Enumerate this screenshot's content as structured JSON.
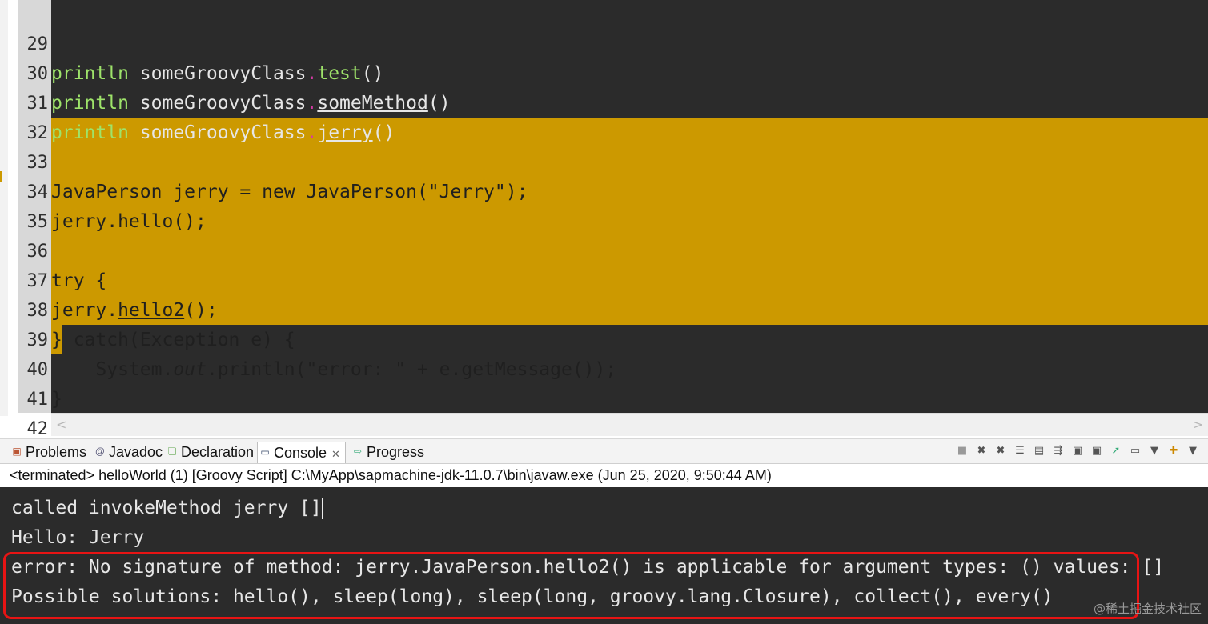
{
  "editor": {
    "lines": [
      {
        "num": "29",
        "pre": "println",
        "mid": " someGroovyClass",
        "dot": ".",
        "call": "test",
        "post": "()"
      },
      {
        "num": "30",
        "pre": "println",
        "mid": " someGroovyClass",
        "dot": ".",
        "call": "someMethod",
        "post": "()"
      },
      {
        "num": "31",
        "pre": "println",
        "mid": " someGroovyClass",
        "dot": ".",
        "call": "jerry",
        "post": "()"
      },
      {
        "num": "32"
      },
      {
        "num": "33",
        "text": "JavaPerson jerry = new JavaPerson(\"Jerry\");"
      },
      {
        "num": "34",
        "text": "jerry.hello();"
      },
      {
        "num": "35"
      },
      {
        "num": "36",
        "text": "try {"
      },
      {
        "num": "37",
        "pre": "jerry.",
        "under": "hello2",
        "post": "();"
      },
      {
        "num": "38",
        "text": "} catch(Exception e) {"
      },
      {
        "num": "39",
        "pre": "    System.",
        "italic": "out",
        "post": ".println(\"error: \" + e.getMessage());"
      },
      {
        "num": "40",
        "text": "}"
      },
      {
        "num": "41"
      },
      {
        "num": "42"
      }
    ]
  },
  "tabs": [
    {
      "label": "Problems",
      "icon": "problems-icon"
    },
    {
      "label": "Javadoc",
      "icon": "javadoc-icon"
    },
    {
      "label": "Declaration",
      "icon": "declaration-icon"
    },
    {
      "label": "Console",
      "icon": "console-icon",
      "active": true,
      "close": "✕"
    },
    {
      "label": "Progress",
      "icon": "progress-icon"
    }
  ],
  "status": "<terminated> helloWorld (1) [Groovy Script] C:\\MyApp\\sapmachine-jdk-11.0.7\\bin\\javaw.exe (Jun 25, 2020, 9:50:44 AM)",
  "console": {
    "lines": [
      "called invokeMethod jerry []",
      "Hello: Jerry",
      "error: No signature of method: jerry.JavaPerson.hello2() is applicable for argument types: () values: []",
      "Possible solutions: hello(), sleep(long), sleep(long, groovy.lang.Closure), collect(), every()"
    ]
  },
  "watermark": "@稀土掘金技术社区",
  "colors": {
    "editor_bg": "#2b2b2b",
    "highlight": "#cc9900",
    "keyword_green": "#9ee36a",
    "dot_magenta": "#d63aa6",
    "error_box": "#e81414"
  }
}
